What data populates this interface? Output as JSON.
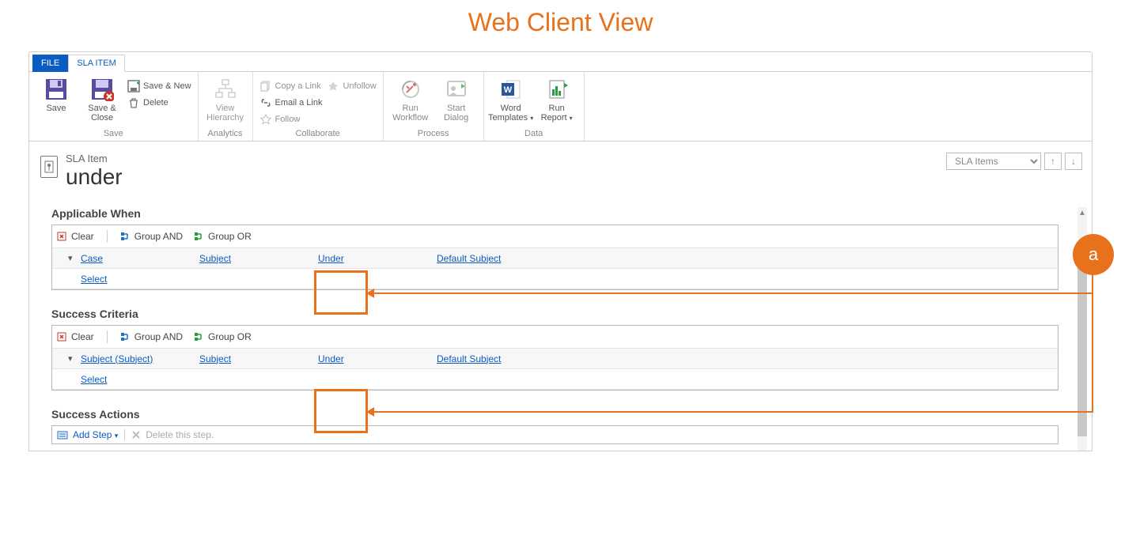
{
  "page_title": "Web Client View",
  "tabs": {
    "file": "FILE",
    "sla_item": "SLA ITEM"
  },
  "ribbon": {
    "save": {
      "group_label": "Save",
      "save": "Save",
      "save_close": "Save &\nClose",
      "save_new": "Save & New",
      "delete": "Delete"
    },
    "analytics": {
      "group_label": "Analytics",
      "view_hierarchy": "View\nHierarchy"
    },
    "collaborate": {
      "group_label": "Collaborate",
      "copy_link": "Copy a Link",
      "email_link": "Email a Link",
      "follow": "Follow",
      "unfollow": "Unfollow"
    },
    "process": {
      "group_label": "Process",
      "run_workflow": "Run\nWorkflow",
      "start_dialog": "Start\nDialog"
    },
    "data": {
      "group_label": "Data",
      "word_templates": "Word\nTemplates",
      "run_report": "Run\nReport"
    }
  },
  "record": {
    "entity_type": "SLA Item",
    "title": "under",
    "view_selector": "SLA Items"
  },
  "sections": {
    "applicable_when": {
      "title": "Applicable When",
      "toolbar": {
        "clear": "Clear",
        "group_and": "Group AND",
        "group_or": "Group OR"
      },
      "row": {
        "entity": "Case",
        "attribute": "Subject",
        "operator": "Under",
        "value": "Default Subject"
      },
      "select": "Select"
    },
    "success_criteria": {
      "title": "Success Criteria",
      "toolbar": {
        "clear": "Clear",
        "group_and": "Group AND",
        "group_or": "Group OR"
      },
      "row": {
        "entity": "Subject (Subject)",
        "attribute": "Subject",
        "operator": "Under",
        "value": "Default Subject"
      },
      "select": "Select"
    },
    "success_actions": {
      "title": "Success Actions",
      "add_step": "Add Step",
      "delete_step": "Delete this step."
    }
  },
  "annotation": {
    "letter": "a"
  }
}
